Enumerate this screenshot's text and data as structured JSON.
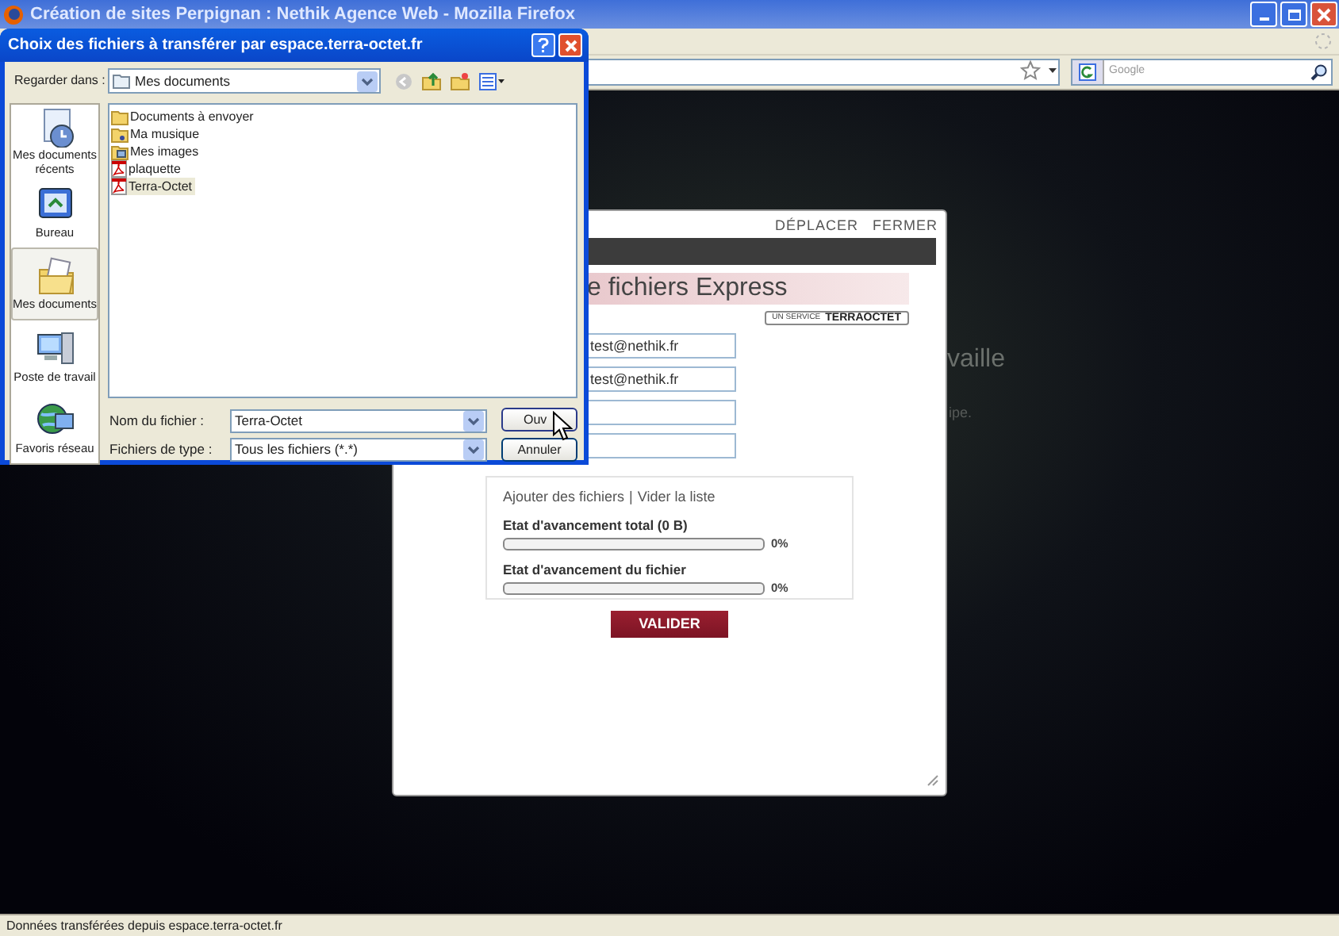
{
  "browser": {
    "title": "Création de sites Perpignan : Nethik Agence Web - Mozilla Firefox",
    "search_placeholder": "Google",
    "status_bar": "Données transférées depuis espace.terra-octet.fr"
  },
  "page": {
    "background_texts": [
      {
        "kind": "heading",
        "text": "vaille"
      },
      {
        "kind": "small",
        "text": "ipe."
      }
    ]
  },
  "upload_panel": {
    "links": [
      "DÉPLACER",
      "FERMER"
    ],
    "title": "e fichiers Express",
    "badge": {
      "prefix": "UN SERVICE",
      "brand": "TERRAOCTET"
    },
    "fields": [
      {
        "kind": "filled",
        "value": "test@nethik.fr"
      },
      {
        "kind": "filled",
        "value": "test@nethik.fr"
      },
      {
        "kind": "blank"
      },
      {
        "kind": "blank"
      }
    ],
    "file_links": [
      "Ajouter des fichiers",
      "Vider la liste"
    ],
    "link_separator": "|",
    "progress": [
      {
        "label": "Etat d'avancement total (0 B)",
        "level": 0,
        "reading": "0%"
      },
      {
        "label": "Etat d'avancement du fichier",
        "level": 0,
        "reading": "0%"
      }
    ],
    "submit": "VALIDER"
  },
  "dialog": {
    "title": "Choix des fichiers à transférer par espace.terra-octet.fr",
    "look_in": {
      "label": "Regarder dans :",
      "value": "Mes documents"
    },
    "places": [
      {
        "kind": "recent",
        "label": "Mes documents récents",
        "selected": false
      },
      {
        "kind": "desktop",
        "label": "Bureau",
        "selected": false
      },
      {
        "kind": "documents",
        "label": "Mes documents",
        "selected": true
      },
      {
        "kind": "computer",
        "label": "Poste de travail",
        "selected": false
      },
      {
        "kind": "network",
        "label": "Favoris réseau",
        "selected": false
      }
    ],
    "files": [
      {
        "kind": "folder",
        "name": "Documents à envoyer",
        "selected": false
      },
      {
        "kind": "music-folder",
        "name": "Ma musique",
        "selected": false
      },
      {
        "kind": "picture-folder",
        "name": "Mes images",
        "selected": false
      },
      {
        "kind": "pdf",
        "name": "plaquette",
        "selected": false
      },
      {
        "kind": "pdf",
        "name": "Terra-Octet",
        "selected": true
      }
    ],
    "filename": {
      "label": "Nom du fichier :",
      "value": "Terra-Octet"
    },
    "filetype": {
      "label": "Fichiers de type :",
      "value": "Tous les fichiers (*.*)"
    },
    "buttons": [
      {
        "kind": "open",
        "label": "Ouv"
      },
      {
        "kind": "cancel",
        "label": "Annuler"
      }
    ]
  }
}
